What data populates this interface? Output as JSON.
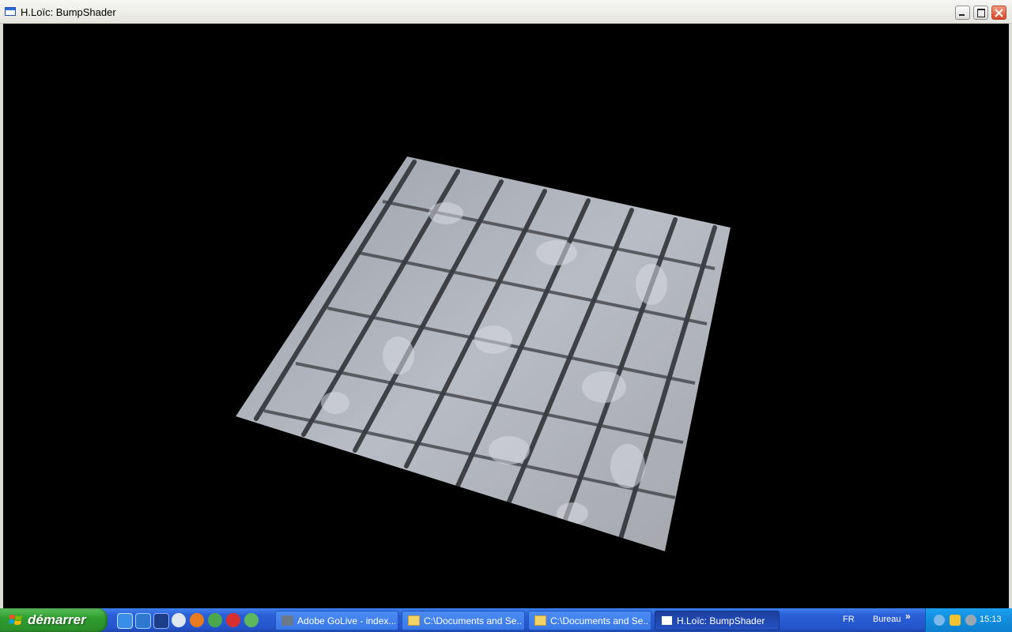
{
  "window": {
    "title": "H.Loïc: BumpShader",
    "icon": "app-window-icon"
  },
  "taskbar": {
    "start_label": "démarrer",
    "quick_launch": [
      "ie-icon",
      "ie-alt-icon",
      "media-icon",
      "player-icon",
      "firefox-icon",
      "network-icon",
      "opera-icon",
      "messenger-icon"
    ],
    "tasks": [
      {
        "label": "Adobe GoLive - index...",
        "icon": "golive-icon"
      },
      {
        "label": "C:\\Documents and Se...",
        "icon": "folder-icon"
      },
      {
        "label": "C:\\Documents and Se...",
        "icon": "folder-icon"
      },
      {
        "label": "H.Loïc: BumpShader",
        "icon": "app-window-icon"
      }
    ],
    "language": "FR",
    "bureau": "Bureau",
    "clock": "15:13"
  },
  "colors": {
    "taskbar": "#2a5fd6",
    "start": "#2f9f2f",
    "tray": "#1290e0",
    "viewport": "#000000"
  }
}
